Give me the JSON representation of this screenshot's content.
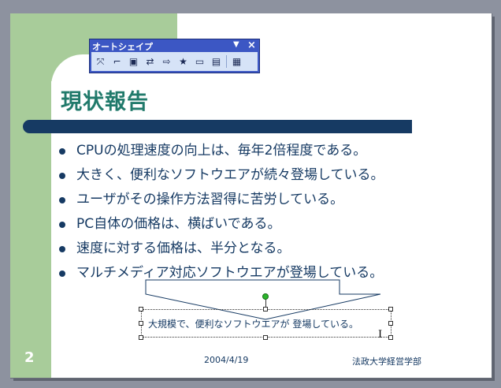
{
  "slide": {
    "number": "2",
    "title": "現状報告",
    "bullets": [
      "CPUの処理速度の向上は、毎年2倍程度である。",
      "大きく、便利なソフトウエアが続々登場している。",
      "ユーザがその操作方法習得に苦労している。",
      "PC自体の価格は、横ばいである。",
      "速度に対する価格は、半分となる。",
      "マルチメディア対応ソフトウエアが登場している。"
    ],
    "callout_text": "大規模で、便利なソフトウエアが 登場している。",
    "footer_date": "2004/4/19",
    "footer_org": "法政大学経営学部"
  },
  "toolbar": {
    "title": "オートシェイプ",
    "menu_glyph": "▼",
    "close_glyph": "×",
    "buttons": [
      {
        "name": "shape-tool-1-icon",
        "glyph": "⤧"
      },
      {
        "name": "shape-tool-2-icon",
        "glyph": "⌐"
      },
      {
        "name": "shape-tool-3-icon",
        "glyph": "▣"
      },
      {
        "name": "shape-tool-4-icon",
        "glyph": "⇄"
      },
      {
        "name": "shape-tool-5-icon",
        "glyph": "⇨"
      },
      {
        "name": "shape-tool-6-icon",
        "glyph": "★"
      },
      {
        "name": "shape-tool-7-icon",
        "glyph": "▭"
      },
      {
        "name": "shape-tool-8-icon",
        "glyph": "▤"
      },
      {
        "name": "more-shapes-icon",
        "glyph": "▦"
      }
    ]
  },
  "colors": {
    "title": "#217a6b",
    "text": "#163a63",
    "accent_green": "#a8cc9a",
    "toolbar_blue": "#3c57c4"
  }
}
